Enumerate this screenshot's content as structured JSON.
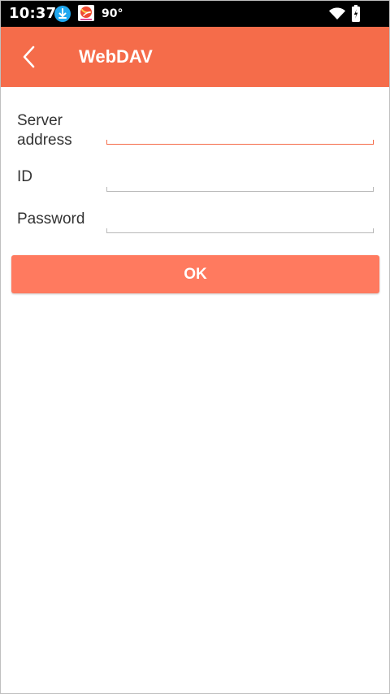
{
  "status_bar": {
    "time": "10:37",
    "temperature": "90°",
    "icons": [
      "download-icon",
      "news-app-icon",
      "wifi-icon",
      "battery-charging-icon"
    ]
  },
  "app_bar": {
    "title": "WebDAV",
    "back_icon": "chevron-left-icon"
  },
  "form": {
    "server_address_label": "Server address",
    "server_address_value": "",
    "id_label": "ID",
    "id_value": "",
    "password_label": "Password",
    "password_value": ""
  },
  "actions": {
    "ok_label": "OK"
  },
  "colors": {
    "accent": "#f56c4a",
    "button": "#ff7a5f",
    "status_bar": "#000000",
    "background": "#ffffff",
    "text": "#333333"
  }
}
